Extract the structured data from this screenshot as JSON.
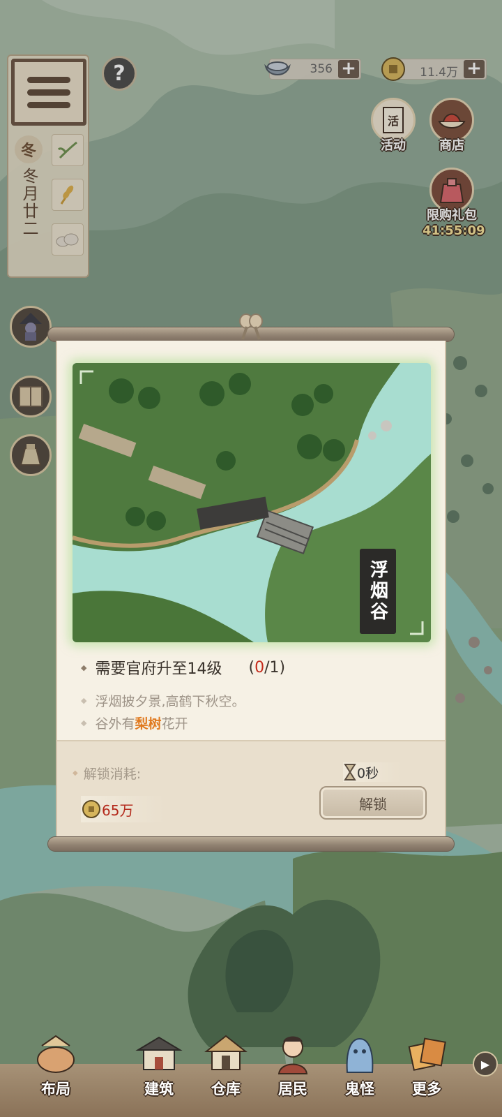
{
  "hud": {
    "menu_label": "menu",
    "season_char": "冬",
    "date": "冬月廿二",
    "help_symbol": "?",
    "silver_value": "356",
    "coin_value": "11.4万",
    "plus": "+"
  },
  "right_buttons": {
    "activity_label": "活动",
    "activity_sign": "活",
    "shop_label": "商店",
    "giftpack_label": "限购礼包",
    "giftpack_timer": "41:55:09"
  },
  "dialog": {
    "place_name": "浮烟谷",
    "requirement_text": "需要官府升至14级",
    "progress_open": "(",
    "progress_current": "0",
    "progress_total": "/1)",
    "desc_line1": "浮烟披夕景,高鹤下秋空。",
    "desc_line2_prefix": "谷外有",
    "desc_line2_highlight": "梨树",
    "desc_line2_suffix": "花开",
    "cost_label": "解锁消耗:",
    "time_value": "0秒",
    "coin_cost": "65万",
    "unlock_button": "解锁"
  },
  "nav": {
    "items": [
      {
        "label": "布局",
        "icon": "layout-icon"
      },
      {
        "label": "建筑",
        "icon": "building-icon"
      },
      {
        "label": "仓库",
        "icon": "warehouse-icon"
      },
      {
        "label": "居民",
        "icon": "resident-icon"
      },
      {
        "label": "鬼怪",
        "icon": "ghost-icon"
      },
      {
        "label": "更多",
        "icon": "more-icon"
      }
    ],
    "arrow": "▶"
  },
  "colors": {
    "highlight_orange": "#e07a20",
    "progress_red": "#c42b1c",
    "river": "#a8ddd0",
    "grass": "#4f7a3f"
  }
}
